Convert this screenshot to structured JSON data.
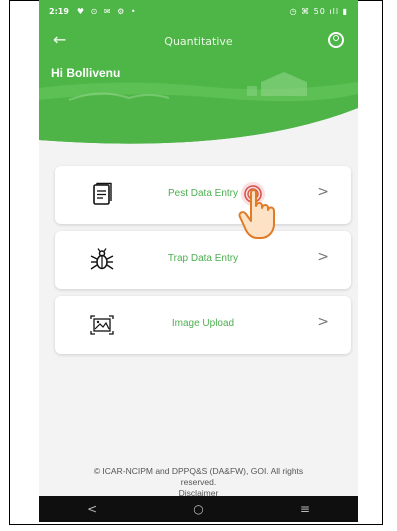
{
  "status": {
    "time": "2:19",
    "left_icons": "♥ ⊙ ✉ ⚙ •",
    "right_icons": "◷ ⌘ 50 ıll ▮"
  },
  "appbar": {
    "title": "Quantitative",
    "back_icon": "arrow-left",
    "profile_icon": "user-circle"
  },
  "greeting": "Hi Bollivenu",
  "menu": [
    {
      "label": "Pest Data Entry",
      "icon": "document-icon",
      "chevron": ">"
    },
    {
      "label": "Trap Data Entry",
      "icon": "bug-icon",
      "chevron": ">"
    },
    {
      "label": "Image Upload",
      "icon": "image-icon",
      "chevron": ">"
    }
  ],
  "footer": {
    "line1": "© ICAR-NCIPM and DPPQ&S (DA&FW), GOI. All rights",
    "line2": "reserved.",
    "line3": "Disclaimer"
  },
  "navbar": {
    "back": "<",
    "home": "○",
    "recents": "≡"
  },
  "colors": {
    "primary": "#4db647",
    "label": "#4caf50",
    "background": "#f3f3f3"
  }
}
